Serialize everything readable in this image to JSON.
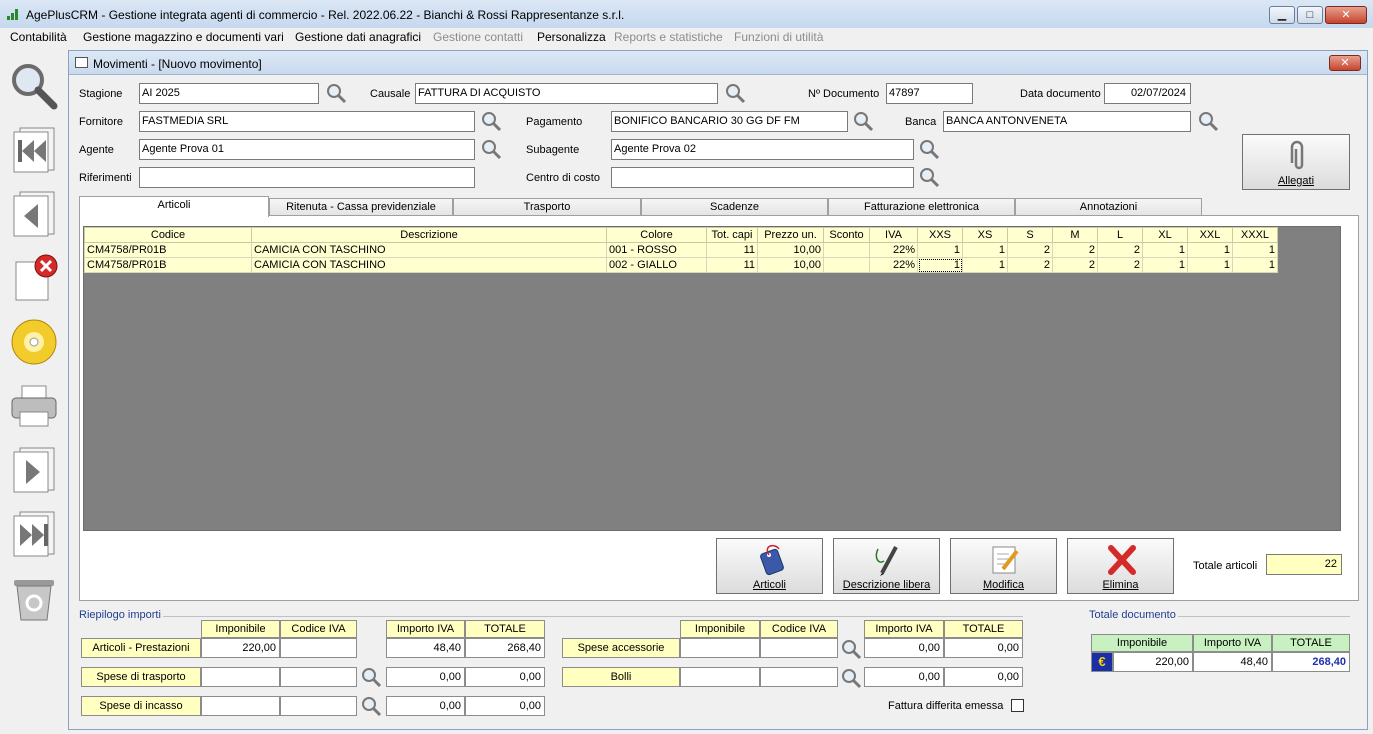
{
  "window": {
    "title": "AgePlusCRM - Gestione integrata agenti di commercio - Rel. 2022.06.22 - Bianchi & Rossi Rappresentanze s.r.l.",
    "minimize": "▁",
    "maximize": "□",
    "close": "✕"
  },
  "menu": [
    {
      "label": "Contabilità",
      "disabled": false
    },
    {
      "label": "Gestione magazzino e documenti vari",
      "disabled": false
    },
    {
      "label": "Gestione dati anagrafici",
      "disabled": false
    },
    {
      "label": "Gestione contatti",
      "disabled": true
    },
    {
      "label": "Personalizza",
      "disabled": false
    },
    {
      "label": "Reports e statistiche",
      "disabled": true
    },
    {
      "label": "Funzioni di utilità",
      "disabled": true
    }
  ],
  "toolbar": [
    "search-icon",
    "first-record-icon",
    "previous-record-icon",
    "delete-record-icon",
    "save-disc-icon",
    "printer-icon",
    "next-record-icon",
    "last-record-icon",
    "recycle-bin-icon"
  ],
  "child": {
    "title": "Movimenti - [Nuovo movimento]",
    "close": "✕"
  },
  "form": {
    "stagione_label": "Stagione",
    "stagione": "AI 2025",
    "causale_label": "Causale",
    "causale": "FATTURA DI ACQUISTO",
    "ndoc_label": "Nº Documento",
    "ndoc": "47897",
    "datadoc_label": "Data documento",
    "datadoc": "02/07/2024",
    "fornitore_label": "Fornitore",
    "fornitore": "FASTMEDIA SRL",
    "pagamento_label": "Pagamento",
    "pagamento": "BONIFICO BANCARIO 30 GG DF FM",
    "banca_label": "Banca",
    "banca": "BANCA ANTONVENETA",
    "agente_label": "Agente",
    "agente": "Agente Prova 01",
    "subagente_label": "Subagente",
    "subagente": "Agente Prova 02",
    "riferimenti_label": "Riferimenti",
    "riferimenti": "",
    "centro_label": "Centro di costo",
    "centro": "",
    "allegati": "Allegati"
  },
  "tabs": [
    "Articoli",
    "Ritenuta - Cassa previdenziale",
    "Trasporto",
    "Scadenze",
    "Fatturazione elettronica",
    "Annotazioni"
  ],
  "grid": {
    "columns": [
      "Codice",
      "Descrizione",
      "Colore",
      "Tot. capi",
      "Prezzo un.",
      "Sconto",
      "IVA",
      "XXS",
      "XS",
      "S",
      "M",
      "L",
      "XL",
      "XXL",
      "XXXL"
    ],
    "rows": [
      [
        "CM4758/PR01B",
        "CAMICIA CON TASCHINO",
        "001 - ROSSO",
        "11",
        "10,00",
        "",
        "22%",
        "1",
        "1",
        "2",
        "2",
        "2",
        "1",
        "1",
        "1"
      ],
      [
        "CM4758/PR01B",
        "CAMICIA CON TASCHINO",
        "002 - GIALLO",
        "11",
        "10,00",
        "",
        "22%",
        "1",
        "1",
        "2",
        "2",
        "2",
        "1",
        "1",
        "1"
      ]
    ]
  },
  "actions": {
    "articoli": "Articoli",
    "descrizione": "Descrizione libera",
    "modifica": "Modifica",
    "elimina": "Elimina",
    "totale_label": "Totale articoli",
    "totale": "22"
  },
  "riepilogo": {
    "title": "Riepilogo importi",
    "h_imponibile": "Imponibile",
    "h_codiva": "Codice IVA",
    "h_importoiva": "Importo IVA",
    "h_totale": "TOTALE",
    "articoli_label": "Articoli - Prestazioni",
    "articoli_imponibile": "220,00",
    "articoli_codiva": "",
    "articoli_iva": "48,40",
    "articoli_totale": "268,40",
    "trasporto_label": "Spese di trasporto",
    "trasporto_imponibile": "",
    "trasporto_codiva": "",
    "trasporto_iva": "0,00",
    "trasporto_totale": "0,00",
    "incasso_label": "Spese di incasso",
    "incasso_imponibile": "",
    "incasso_codiva": "",
    "incasso_iva": "0,00",
    "incasso_totale": "0,00",
    "accessorie_label": "Spese accessorie",
    "accessorie_imponibile": "",
    "accessorie_codiva": "",
    "accessorie_iva": "0,00",
    "accessorie_totale": "0,00",
    "bolli_label": "Bolli",
    "bolli_imponibile": "",
    "bolli_codiva": "",
    "bolli_iva": "0,00",
    "bolli_totale": "0,00",
    "differita_label": "Fattura differita emessa"
  },
  "totale_doc": {
    "title": "Totale documento",
    "h_imponibile": "Imponibile",
    "h_importoiva": "Importo IVA",
    "h_totale": "TOTALE",
    "currency": "€",
    "imponibile": "220,00",
    "iva": "48,40",
    "totale": "268,40"
  }
}
